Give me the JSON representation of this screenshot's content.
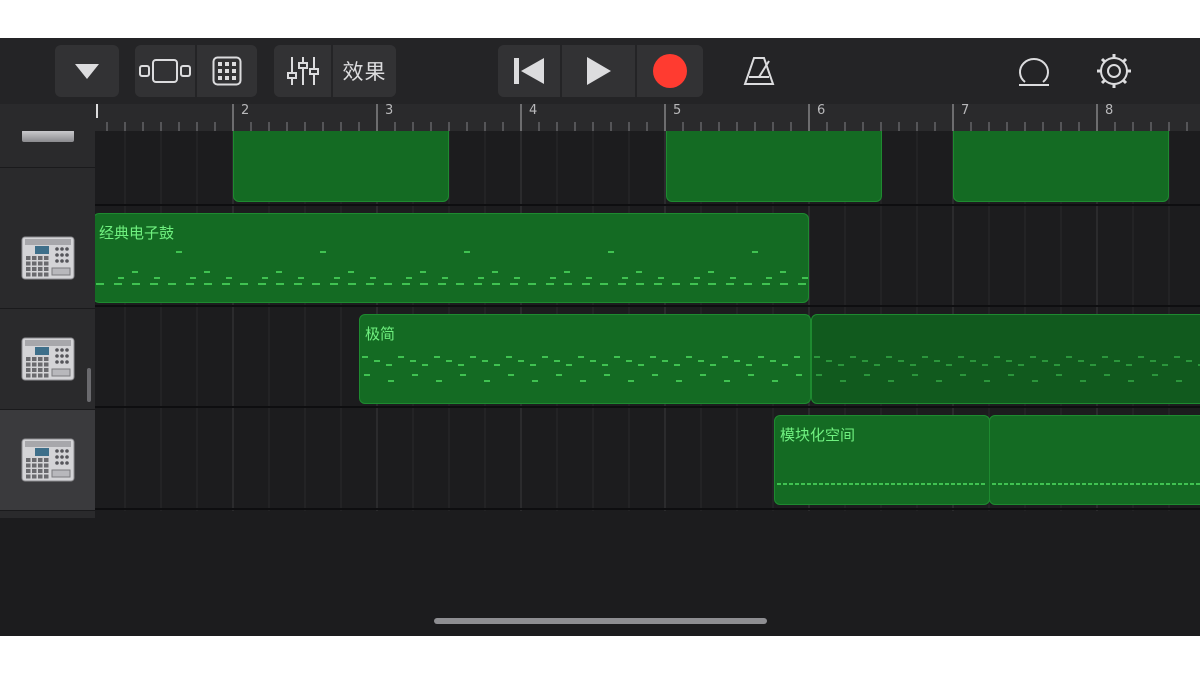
{
  "toolbar": {
    "effects_label": "效果",
    "icons": [
      "chevron-down-icon",
      "track-view-icon",
      "grid-icon",
      "mixer-icon",
      "rewind-icon",
      "play-icon",
      "record-icon",
      "metronome-icon",
      "loop-icon",
      "settings-icon"
    ],
    "record_color": "#ff3b30"
  },
  "ruler": {
    "bars": [
      "2",
      "3",
      "4",
      "5",
      "6",
      "7",
      "8"
    ]
  },
  "tracks": [
    {
      "instrument_icon": "drum-machine-icon",
      "selected": false
    },
    {
      "instrument_icon": "drum-machine-icon",
      "selected": false
    },
    {
      "instrument_icon": "drum-machine-icon",
      "selected": true
    }
  ],
  "regions": [
    {
      "track": 1,
      "name": "经典电子鼓"
    },
    {
      "track": 2,
      "name": "极简"
    },
    {
      "track": 3,
      "name": "模块化空间"
    }
  ],
  "colors": {
    "region_fill": "#146b23",
    "region_text": "#6ff07f",
    "background": "#1c1c1e"
  }
}
